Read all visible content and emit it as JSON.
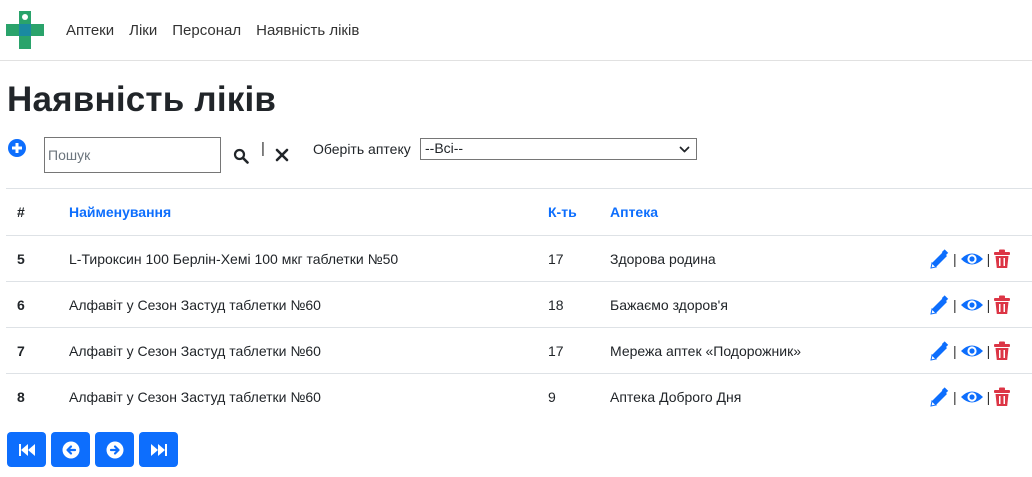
{
  "nav": {
    "logo_icon": "pharmacy-logo-icon",
    "links": [
      "Аптеки",
      "Ліки",
      "Персонал",
      "Наявність ліків"
    ]
  },
  "page": {
    "title": "Наявність ліків"
  },
  "toolbar": {
    "search_placeholder": "Пошук",
    "separator": "|",
    "select_label": "Оберіть аптеку",
    "select_value": "--Всі--"
  },
  "table": {
    "headers": [
      "#",
      "Найменування",
      "К-ть",
      "Аптека"
    ],
    "rows": [
      {
        "id": "5",
        "name": "L-Тироксин 100 Берлін-Хемі 100 мкг таблетки №50",
        "qty": "17",
        "pharmacy": "Здорова родина"
      },
      {
        "id": "6",
        "name": "Алфавіт у Сезон Застуд таблетки №60",
        "qty": "18",
        "pharmacy": "Бажаємо здоров'я"
      },
      {
        "id": "7",
        "name": "Алфавіт у Сезон Застуд таблетки №60",
        "qty": "17",
        "pharmacy": "Мережа аптек «Подорожник»"
      },
      {
        "id": "8",
        "name": "Алфавіт у Сезон Застуд таблетки №60",
        "qty": "9",
        "pharmacy": "Аптека Доброго Дня"
      }
    ],
    "action_separator": "|"
  },
  "colors": {
    "primary": "#0d6efd",
    "danger": "#dc3545",
    "logo_green": "#2aa36b",
    "logo_teal": "#1a8aa0"
  }
}
